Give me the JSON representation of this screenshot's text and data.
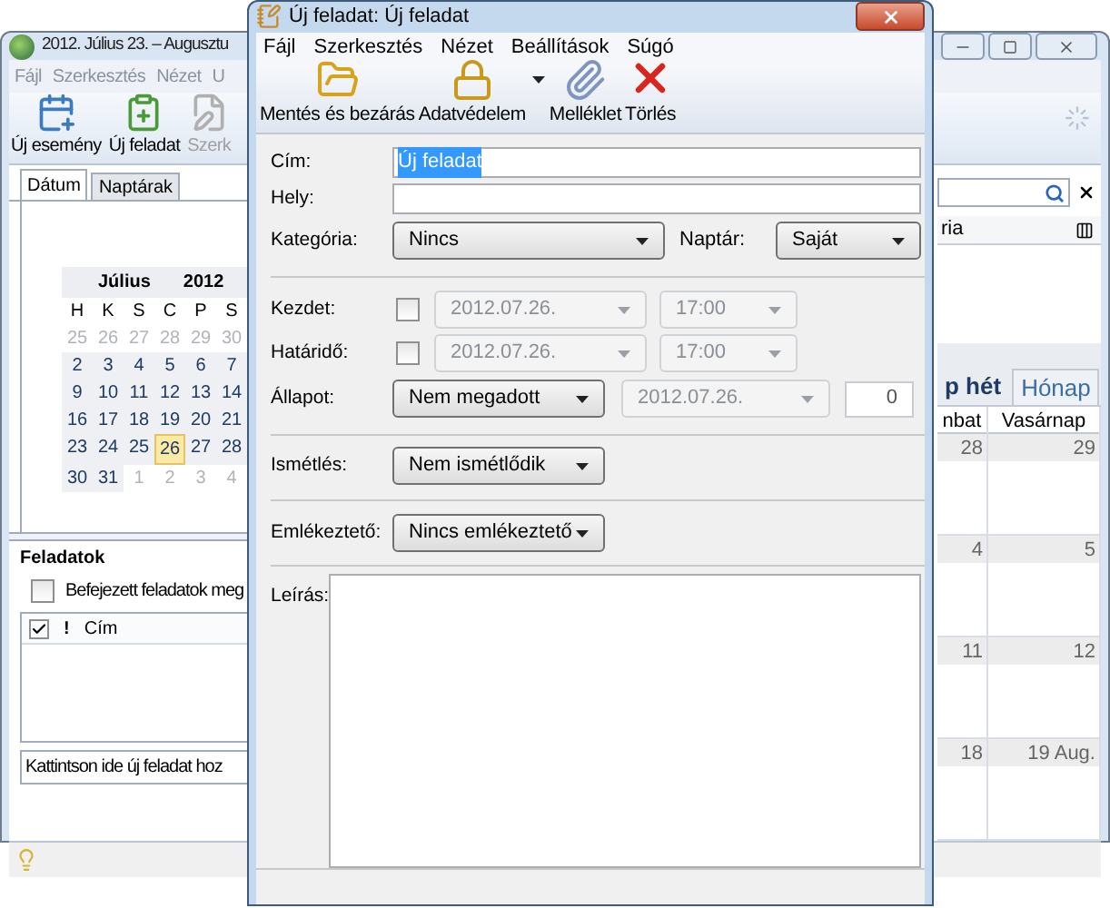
{
  "main_window": {
    "title": "2012. Július 23. – Augusztu",
    "menu": [
      "Fájl",
      "Szerkesztés",
      "Nézet",
      "U"
    ],
    "toolbar": [
      {
        "label": "Új esemény",
        "kind": "event",
        "disabled": false
      },
      {
        "label": "Új feladat",
        "kind": "task",
        "disabled": false
      },
      {
        "label": "Szerk",
        "kind": "edit",
        "disabled": true
      }
    ],
    "tabs": [
      {
        "label": "Dátum",
        "selected": true
      },
      {
        "label": "Naptárak",
        "selected": false
      }
    ],
    "mini_calendar": {
      "month": "Július",
      "year": "2012",
      "weekdays": [
        "H",
        "K",
        "S",
        "C",
        "P",
        "S"
      ],
      "weeks": [
        [
          {
            "day": "25",
            "other_month": true,
            "today": false
          },
          {
            "day": "26",
            "other_month": true,
            "today": false
          },
          {
            "day": "27",
            "other_month": true,
            "today": false
          },
          {
            "day": "28",
            "other_month": true,
            "today": false
          },
          {
            "day": "29",
            "other_month": true,
            "today": false
          },
          {
            "day": "30",
            "other_month": true,
            "today": false
          }
        ],
        [
          {
            "day": "2",
            "other_month": false,
            "today": false
          },
          {
            "day": "3",
            "other_month": false,
            "today": false
          },
          {
            "day": "4",
            "other_month": false,
            "today": false
          },
          {
            "day": "5",
            "other_month": false,
            "today": false
          },
          {
            "day": "6",
            "other_month": false,
            "today": false
          },
          {
            "day": "7",
            "other_month": false,
            "today": false
          }
        ],
        [
          {
            "day": "9",
            "other_month": false,
            "today": false
          },
          {
            "day": "10",
            "other_month": false,
            "today": false
          },
          {
            "day": "11",
            "other_month": false,
            "today": false
          },
          {
            "day": "12",
            "other_month": false,
            "today": false
          },
          {
            "day": "13",
            "other_month": false,
            "today": false
          },
          {
            "day": "14",
            "other_month": false,
            "today": false
          }
        ],
        [
          {
            "day": "16",
            "other_month": false,
            "today": false
          },
          {
            "day": "17",
            "other_month": false,
            "today": false
          },
          {
            "day": "18",
            "other_month": false,
            "today": false
          },
          {
            "day": "19",
            "other_month": false,
            "today": false
          },
          {
            "day": "20",
            "other_month": false,
            "today": false
          },
          {
            "day": "21",
            "other_month": false,
            "today": false
          }
        ],
        [
          {
            "day": "23",
            "other_month": false,
            "today": false
          },
          {
            "day": "24",
            "other_month": false,
            "today": false
          },
          {
            "day": "25",
            "other_month": false,
            "today": false
          },
          {
            "day": "26",
            "other_month": false,
            "today": true
          },
          {
            "day": "27",
            "other_month": false,
            "today": false
          },
          {
            "day": "28",
            "other_month": false,
            "today": false
          }
        ],
        [
          {
            "day": "30",
            "other_month": false,
            "today": false
          },
          {
            "day": "31",
            "other_month": false,
            "today": false
          },
          {
            "day": "1",
            "other_month": true,
            "today": false
          },
          {
            "day": "2",
            "other_month": true,
            "today": false
          },
          {
            "day": "3",
            "other_month": true,
            "today": false
          },
          {
            "day": "4",
            "other_month": true,
            "today": false
          }
        ]
      ]
    },
    "tasks": {
      "title": "Feladatok",
      "show_completed": {
        "label": "Befejezett feladatok meg",
        "checked": false
      },
      "priority_header": "!",
      "title_header": "Cím",
      "new_task_hint": "Kattintson ide új feladat hoz"
    },
    "search_column_header": "ria",
    "view_tabs": [
      {
        "label": "p hét",
        "selected": true
      },
      {
        "label": "Hónap",
        "selected": false
      }
    ],
    "month_grid": {
      "columns": [
        "nbat",
        "Vasárnap"
      ],
      "rows": [
        [
          "28",
          "29"
        ],
        [
          "4",
          "5"
        ],
        [
          "11",
          "12"
        ],
        [
          "18",
          "19 Aug."
        ]
      ]
    }
  },
  "dialog": {
    "title": "Új feladat: Új feladat",
    "menu": [
      "Fájl",
      "Szerkesztés",
      "Nézet",
      "Beállítások",
      "Súgó"
    ],
    "toolbar": [
      {
        "label": "Mentés és bezárás",
        "kind": "save",
        "dropdown": false
      },
      {
        "label": "Adatvédelem",
        "kind": "privacy",
        "dropdown": true
      },
      {
        "label": "Melléklet",
        "kind": "attach",
        "dropdown": false
      },
      {
        "label": "Törlés",
        "kind": "delete",
        "dropdown": false
      }
    ],
    "title_field": {
      "label": "Cím:",
      "value": "Új feladat"
    },
    "location_field": {
      "label": "Hely:"
    },
    "category": {
      "label": "Kategória:",
      "value": "Nincs"
    },
    "calendar": {
      "label": "Naptár:",
      "value": "Saját"
    },
    "start": {
      "label": "Kezdet:",
      "checked": false,
      "date": "2012.07.26.",
      "time": "17:00"
    },
    "due": {
      "label": "Határidő:",
      "checked": false,
      "date": "2012.07.26.",
      "time": "17:00"
    },
    "status": {
      "label": "Állapot:",
      "value": "Nem megadott",
      "date": "2012.07.26.",
      "percent": "0"
    },
    "repeat": {
      "label": "Ismétlés:",
      "value": "Nem ismétlődik"
    },
    "reminder": {
      "label": "Emlékeztető:",
      "value": "Nincs emlékeztető"
    },
    "description": {
      "label": "Leírás:"
    }
  }
}
